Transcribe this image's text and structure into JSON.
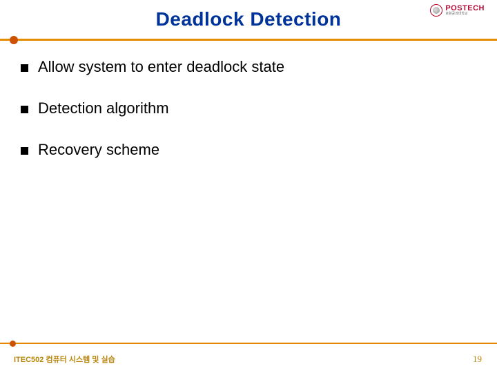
{
  "header": {
    "title": "Deadlock Detection",
    "logo": {
      "main": "POSTECH",
      "sub": "포항공과대학교"
    }
  },
  "bullets": [
    "Allow system to enter deadlock state",
    "Detection algorithm",
    "Recovery scheme"
  ],
  "footer": {
    "left": "ITEC502 컴퓨터 시스템 및 실습",
    "right": "19"
  }
}
